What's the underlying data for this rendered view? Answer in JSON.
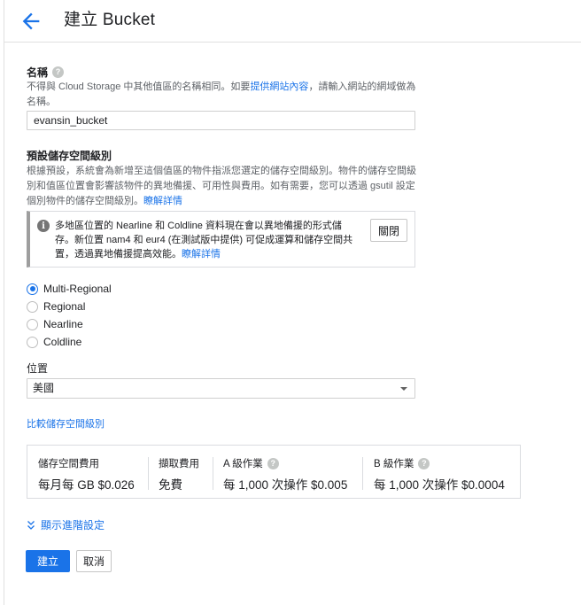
{
  "header": {
    "title": "建立 Bucket",
    "back_icon": "arrow-back-icon"
  },
  "name_section": {
    "label": "名稱",
    "help_icon": "help-icon",
    "help_before": "不得與 Cloud Storage 中其他值區的名稱相同。如要",
    "help_link": "提供網站內容",
    "help_after": "，請輸入網站的網域做為名稱。",
    "input_value": "evansin_bucket"
  },
  "storage_class_section": {
    "label": "預設儲存空間級別",
    "description": "根據預設，系統會為新增至這個值區的物件指派您選定的儲存空間級別。物件的儲存空間級別和值區位置會影響該物件的異地備援、可用性與費用。如有需要，您可以透過 gsutil 設定個別物件的儲存空間級別。",
    "learn_more": "瞭解詳情"
  },
  "notice": {
    "icon": "info-icon",
    "text": "多地區位置的 Nearline 和 Coldline 資料現在會以異地備援的形式儲存。新位置 nam4 和 eur4 (在測試版中提供) 可促成運算和儲存空間共置，透過異地備援提高效能。",
    "learn_more": "瞭解詳情",
    "close_label": "關閉"
  },
  "storage_classes": [
    {
      "label": "Multi-Regional",
      "checked": true
    },
    {
      "label": "Regional",
      "checked": false
    },
    {
      "label": "Nearline",
      "checked": false
    },
    {
      "label": "Coldline",
      "checked": false
    }
  ],
  "location": {
    "label": "位置",
    "selected": "美國"
  },
  "compare_link": "比較儲存空間級別",
  "pricing": [
    {
      "title": "儲存空間費用",
      "value": "每月每 GB $0.026",
      "has_help": false
    },
    {
      "title": "擷取費用",
      "value": "免費",
      "has_help": false
    },
    {
      "title": "A 級作業",
      "value": "每 1,000 次操作 $0.005",
      "has_help": true
    },
    {
      "title": "B 級作業",
      "value": "每 1,000 次操作 $0.0004",
      "has_help": true
    }
  ],
  "advanced_label": "顯示進階設定",
  "actions": {
    "create": "建立",
    "cancel": "取消"
  },
  "colors": {
    "accent": "#1a73e8",
    "text": "#202124",
    "muted": "#5f6368",
    "border": "#dadce0"
  }
}
